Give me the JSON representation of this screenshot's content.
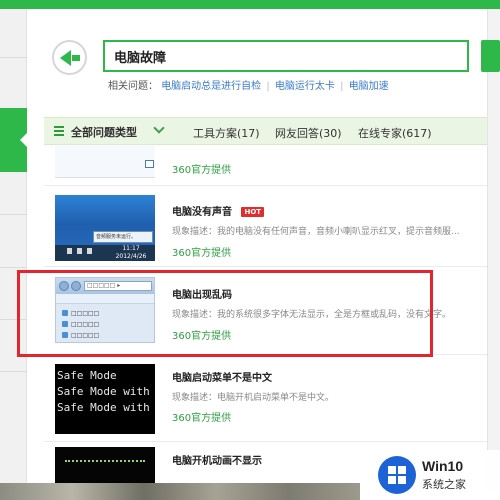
{
  "search": {
    "query": "电脑故障",
    "related_label": "相关问题：",
    "related_links": [
      "电脑启动总是进行自检",
      "电脑运行太卡",
      "电脑加速"
    ]
  },
  "filter_bar": {
    "all_types_label": "全部问题类型",
    "tabs": [
      "工具方案(17)",
      "网友回答(30)",
      "在线专家(617)"
    ]
  },
  "results": [
    {
      "title": "",
      "desc": "",
      "source": "360官方提供"
    },
    {
      "title": "电脑没有声音",
      "badge": "HOT",
      "desc": "现象描述：我的电脑没有任何声音，音频小喇叭显示红叉，提示音频服...",
      "source": "360官方提供",
      "thumb_popup": "音频服务未运行。",
      "thumb_time": "11:17",
      "thumb_date": "2012/4/26"
    },
    {
      "title": "电脑出现乱码",
      "desc": "现象描述：我的系统很多字体无法显示，全是方框或乱码，没有文字。",
      "source": "360官方提供",
      "thumb_address": "□□□□□ ▸",
      "thumb_items": [
        "□□□□□",
        "□□□□□",
        "□□□□□"
      ]
    },
    {
      "title": "电脑启动菜单不是中文",
      "desc": "现象描述：电脑开机启动菜单不是中文。",
      "source": "360官方提供",
      "thumb_lines": [
        "Safe Mode",
        "Safe Mode with",
        "Safe Mode with"
      ]
    },
    {
      "title": "电脑开机动画不显示"
    }
  ],
  "watermark": {
    "title": "Win10",
    "subtitle": "系统之家"
  },
  "colors": {
    "brand_green": "#2fb84a",
    "highlight_red": "#e3262e",
    "link_blue": "#3a7ccf"
  }
}
